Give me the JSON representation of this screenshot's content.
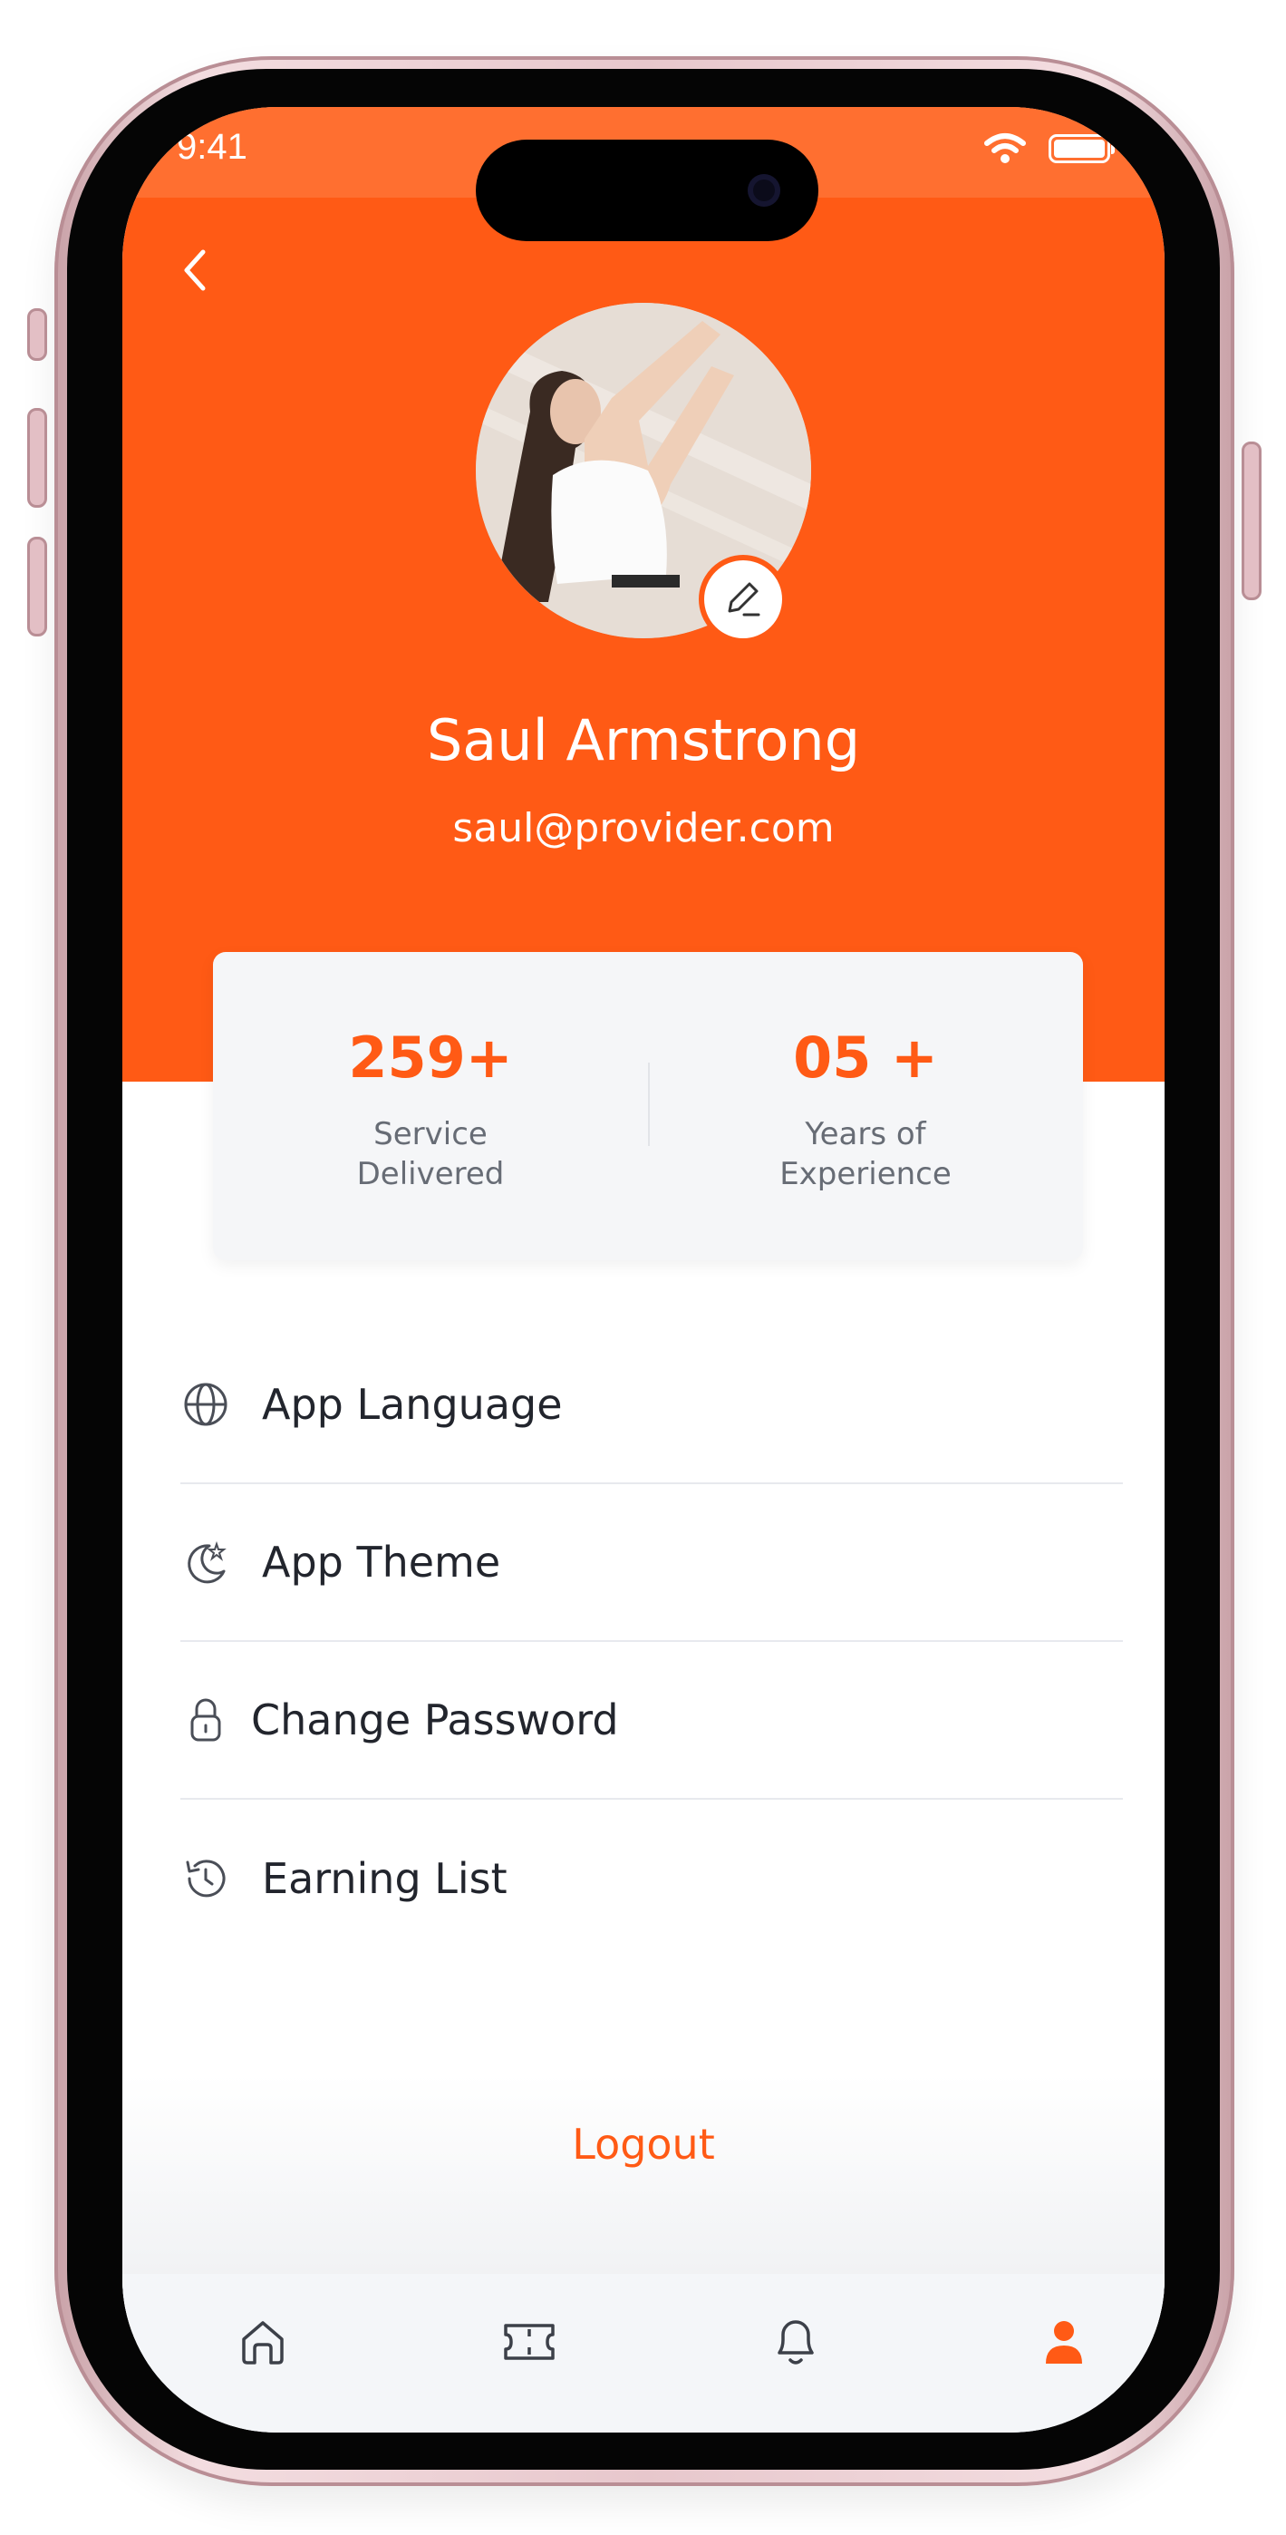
{
  "status_bar": {
    "time": "9:41"
  },
  "profile": {
    "name": "Saul Armstrong",
    "email": "saul@provider.com"
  },
  "stats": [
    {
      "value": "259+",
      "label": "Service\nDelivered"
    },
    {
      "value": "05 +",
      "label": "Years of\nExperience"
    }
  ],
  "menu": [
    {
      "label": "App Language",
      "icon": "globe-icon"
    },
    {
      "label": "App Theme",
      "icon": "moon-star-icon"
    },
    {
      "label": "Change Password",
      "icon": "lock-icon"
    },
    {
      "label": "Earning List",
      "icon": "history-icon"
    }
  ],
  "logout_label": "Logout",
  "tabs": [
    {
      "icon": "home-icon",
      "active": false
    },
    {
      "icon": "ticket-icon",
      "active": false
    },
    {
      "icon": "bell-icon",
      "active": false
    },
    {
      "icon": "profile-icon",
      "active": true
    }
  ],
  "colors": {
    "accent": "#ff5a15",
    "text": "#22252d",
    "muted": "#676c75",
    "tab_inactive": "#3c4049"
  }
}
